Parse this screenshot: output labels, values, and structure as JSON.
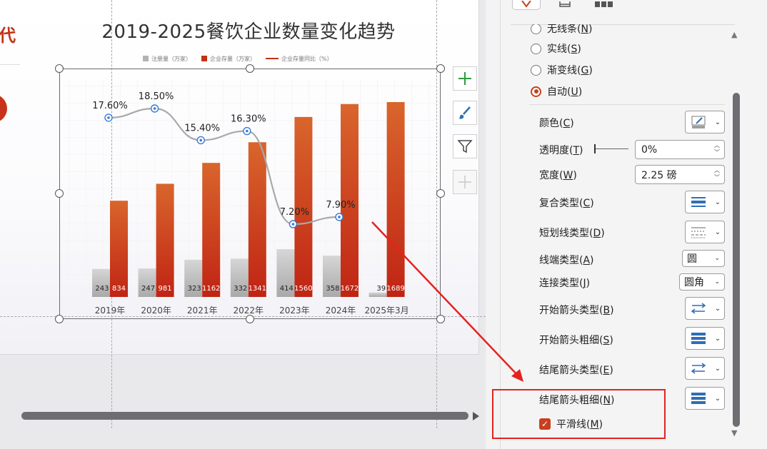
{
  "slide": {
    "title": "2019-2025餐饮企业数量变化趋势",
    "side_text": "代"
  },
  "legend": {
    "items": [
      {
        "label": "注册量（万家）",
        "color": "#b3b3b3",
        "kind": "bar"
      },
      {
        "label": "企业存量（万家）",
        "color": "#c23216",
        "kind": "bar"
      },
      {
        "label": "企业存量同比（%）",
        "color": "#c23216",
        "kind": "line"
      }
    ]
  },
  "chart_data": {
    "type": "bar",
    "title": "2019-2025餐饮企业数量变化趋势",
    "categories": [
      "2019年",
      "2020年",
      "2021年",
      "2022年",
      "2023年",
      "2024年",
      "2025年3月"
    ],
    "series": [
      {
        "name": "注册量（万家）",
        "type": "bar",
        "color": "#b3b3b3",
        "values": [
          243,
          247,
          323,
          332,
          414,
          358,
          39
        ]
      },
      {
        "name": "企业存量（万家）",
        "type": "bar",
        "color": "#c23216",
        "values": [
          834,
          981,
          1162,
          1341,
          1560,
          1672,
          1689
        ]
      },
      {
        "name": "企业存量同比（%）",
        "type": "line",
        "color": "#a9a9a9",
        "values": [
          17.6,
          18.5,
          15.4,
          16.3,
          7.2,
          7.9
        ],
        "labels": [
          "17.60%",
          "18.50%",
          "15.40%",
          "16.30%",
          "7.20%",
          "7.90%"
        ]
      }
    ],
    "legend_position": "top",
    "grid": true
  },
  "chart_tools": {
    "add_element": "+",
    "style": "brush-icon",
    "filter": "filter-icon"
  },
  "panel": {
    "radios": [
      {
        "label": "无线条(N)",
        "main": "无线条",
        "key": "N",
        "checked": false
      },
      {
        "label": "实线(S)",
        "main": "实线",
        "key": "S",
        "checked": false
      },
      {
        "label": "渐变线(G)",
        "main": "渐变线",
        "key": "G",
        "checked": false
      },
      {
        "label": "自动(U)",
        "main": "自动",
        "key": "U",
        "checked": true
      }
    ],
    "color": {
      "main": "颜色",
      "key": "C"
    },
    "transparency": {
      "main": "透明度",
      "key": "T",
      "value": "0%"
    },
    "width": {
      "main": "宽度",
      "key": "W",
      "value": "2.25 磅"
    },
    "compound": {
      "main": "复合类型",
      "key": "C"
    },
    "dash": {
      "main": "短划线类型",
      "key": "D"
    },
    "cap": {
      "main": "线端类型",
      "key": "A",
      "value": "圆"
    },
    "join": {
      "main": "连接类型",
      "key": "J",
      "value": "圆角"
    },
    "begin_arrow_type": {
      "main": "开始箭头类型",
      "key": "B"
    },
    "begin_arrow_size": {
      "main": "开始箭头粗细",
      "key": "S"
    },
    "end_arrow_type": {
      "main": "结尾箭头类型",
      "key": "E"
    },
    "end_arrow_size": {
      "main": "结尾箭头粗细",
      "key": "N"
    },
    "smooth": {
      "main": "平滑线",
      "key": "M",
      "checked": true
    }
  },
  "colors": {
    "accent": "#c8401f",
    "bar_red": "#c23216",
    "bar_gray": "#b3b3b3",
    "highlight": "#e5221f"
  }
}
